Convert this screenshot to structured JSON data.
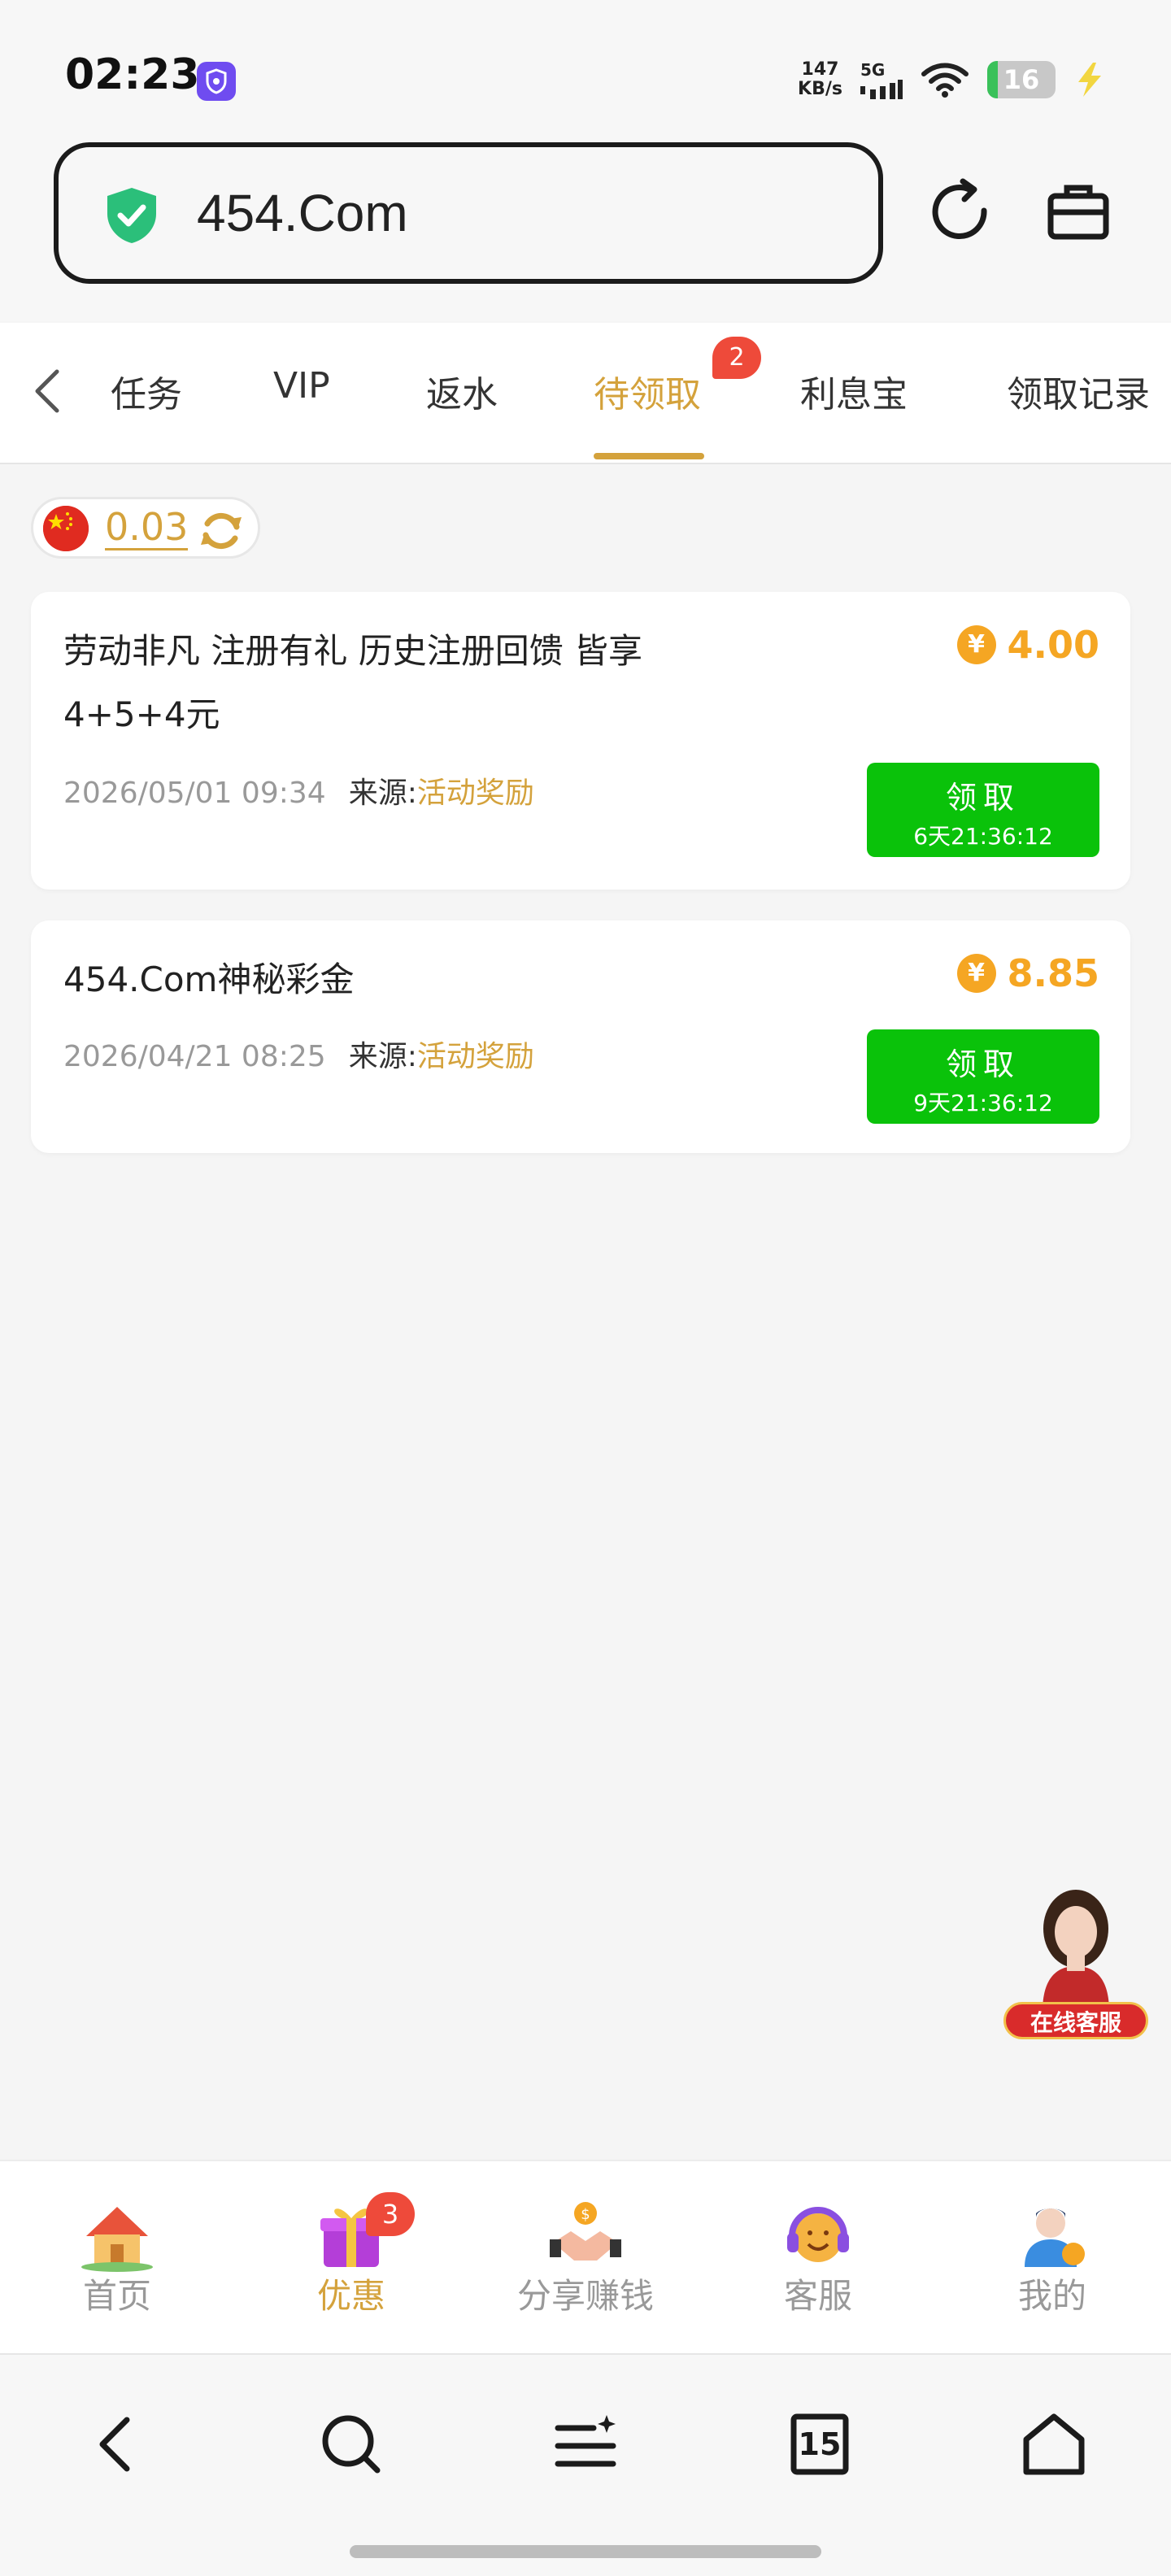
{
  "status_bar": {
    "time": "02:23",
    "net_speed_value": "147",
    "net_speed_unit": "KB/s",
    "signal_type": "5G",
    "battery_level": "16",
    "battery_fraction": 0.16
  },
  "browser": {
    "url": "454.Com"
  },
  "tabs": {
    "items": [
      "任务",
      "VIP",
      "返水",
      "待领取",
      "利息宝",
      "领取记录"
    ],
    "active_index": 3,
    "active_badge": "2"
  },
  "wallet": {
    "balance": "0.03"
  },
  "rewards": [
    {
      "title_line1": "劳动非凡 注册有礼 历史注册回馈 皆享",
      "title_line2": "4+5+4元",
      "amount": "4.00",
      "datetime": "2026/05/01 09:34",
      "source_label": "来源:",
      "source_value": "活动奖励",
      "button_label": "领取",
      "countdown": "6天21:36:12"
    },
    {
      "title_line1": "454.Com神秘彩金",
      "title_line2": "",
      "amount": "8.85",
      "datetime": "2026/04/21 08:25",
      "source_label": "来源:",
      "source_value": "活动奖励",
      "button_label": "领取",
      "countdown": "9天21:36:12"
    }
  ],
  "currency_symbol": "¥",
  "float_service": {
    "label": "在线客服"
  },
  "bottom_nav": {
    "items": [
      {
        "label": "首页",
        "icon": "house-icon"
      },
      {
        "label": "优惠",
        "icon": "gift-icon",
        "badge": "3"
      },
      {
        "label": "分享赚钱",
        "icon": "handshake-coin-icon"
      },
      {
        "label": "客服",
        "icon": "headset-icon"
      },
      {
        "label": "我的",
        "icon": "user-icon"
      }
    ],
    "active_index": 1
  },
  "browser_toolbar": {
    "tabs_count": "15",
    "icons": [
      "back-icon",
      "search-icon",
      "menu-icon",
      "tabs-icon",
      "home-icon"
    ]
  },
  "colors": {
    "accent_gold": "#d4a23c",
    "claim_green": "#0ac20a",
    "amount_orange": "#f5a623",
    "badge_red": "#ee4a3a"
  }
}
